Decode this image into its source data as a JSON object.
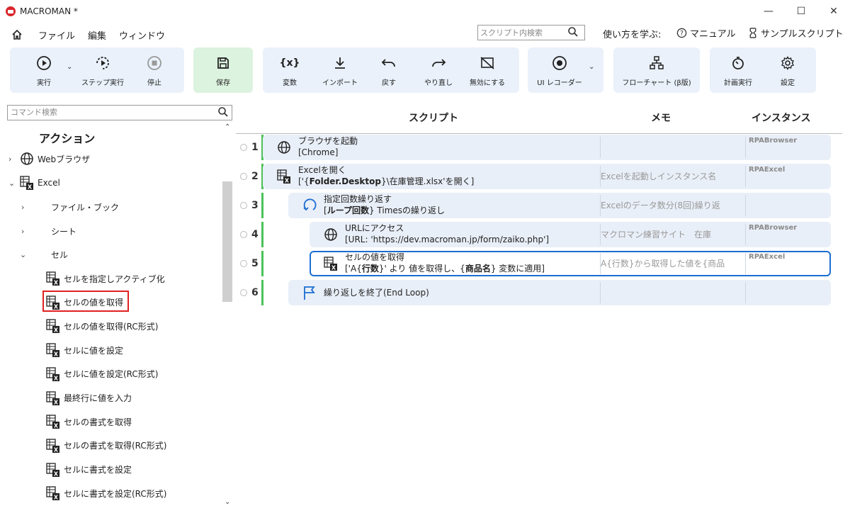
{
  "window": {
    "title": "MACROMAN *",
    "controls": [
      "—",
      "☐",
      "✕"
    ]
  },
  "menu": {
    "items": [
      "ファイル",
      "編集",
      "ウィンドウ"
    ],
    "script_search_placeholder": "スクリプト内検索",
    "help_label": "使い方を学ぶ:",
    "manual": "マニュアル",
    "samples": "サンプルスクリプト"
  },
  "toolbar": {
    "run": "実行",
    "step_run": "ステップ実行",
    "stop": "停止",
    "save": "保存",
    "variables": "変数",
    "import": "インポート",
    "undo": "戻す",
    "redo": "やり直し",
    "disable": "無効にする",
    "ui_recorder": "UI レコーダー",
    "flowchart": "フローチャート (β版)",
    "schedule": "計画実行",
    "settings": "設定"
  },
  "left": {
    "command_search_placeholder": "コマンド検索",
    "heading": "アクション",
    "web_browser": "Webブラウザ",
    "excel": "Excel",
    "file_book": "ファイル・ブック",
    "sheet": "シート",
    "cell": "セル",
    "items": [
      "セルを指定しアクティブ化",
      "セルの値を取得",
      "セルの値を取得(RC形式)",
      "セルに値を設定",
      "セルに値を設定(RC形式)",
      "最終行に値を入力",
      "セルの書式を取得",
      "セルの書式を取得(RC形式)",
      "セルに書式を設定",
      "セルに書式を設定(RC形式)"
    ]
  },
  "script": {
    "col_script": "スクリプト",
    "col_memo": "メモ",
    "col_instance": "インスタンス",
    "rows": [
      {
        "num": "1",
        "icon": "globe-icon",
        "line1": "ブラウザを起動",
        "line2a": "[Chrome]",
        "line2b": "",
        "line2c": "",
        "line2d": "",
        "line2e": "",
        "memo": "",
        "instance": "RPABrowser"
      },
      {
        "num": "2",
        "icon": "excel-icon",
        "line1": "Excelを開く",
        "line2a": "['{",
        "line2b": "Folder.Desktop",
        "line2c": "}\\在庫管理.xlsx'を開く]",
        "line2d": "",
        "line2e": "",
        "memo": "Excelを起動しインスタンス名",
        "instance": "RPAExcel"
      },
      {
        "num": "3",
        "icon": "loop-icon",
        "line1": "指定回数繰り返す",
        "line2a": "[",
        "line2b": "ループ回数",
        "line2c": "} Timesの繰り返し",
        "line2d": "",
        "line2e": "",
        "memo": "Excelのデータ数分(8回)繰り返",
        "instance": ""
      },
      {
        "num": "4",
        "icon": "globe-icon",
        "line1": "URLにアクセス",
        "line2a": "[URL: 'https://dev.macroman.jp/form/zaiko.php']",
        "line2b": "",
        "line2c": "",
        "line2d": "",
        "line2e": "",
        "memo": "マクロマン練習サイト　在庫",
        "instance": "RPABrowser"
      },
      {
        "num": "5",
        "icon": "excel-icon",
        "line1": "セルの値を取得",
        "line2a": "['A{",
        "line2b": "行数",
        "line2c": "}' より 値を取得し、{",
        "line2d": "商品名",
        "line2e": "} 変数に適用]",
        "memo": "A{行数}から取得した値を{商品",
        "instance": "RPAExcel"
      },
      {
        "num": "6",
        "icon": "flag-icon",
        "line1": "繰り返しを終了(End Loop)",
        "line2a": "",
        "line2b": "",
        "line2c": "",
        "line2d": "",
        "line2e": "",
        "memo": "",
        "instance": ""
      }
    ]
  },
  "colors": {
    "accent_blue": "#1b6ed0",
    "row_bg": "#e9eff8",
    "save_bg": "#dcf3df",
    "green_bar": "#4cc25a",
    "highlight_red": "#e02020"
  }
}
